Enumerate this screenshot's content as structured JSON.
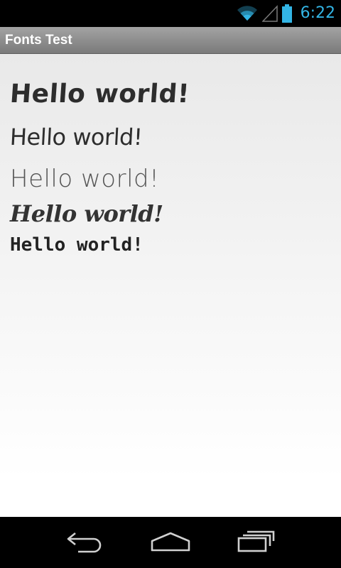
{
  "status_bar": {
    "time": "6:22",
    "icons": [
      "wifi-icon",
      "signal-icon",
      "battery-icon"
    ],
    "accent_color": "#33b5e5"
  },
  "app": {
    "title": "Fonts Test"
  },
  "samples": [
    {
      "text": "Hello world!"
    },
    {
      "text": "Hello world!"
    },
    {
      "text": "Hello world!"
    },
    {
      "text": "Hello world!"
    },
    {
      "text": "Hello world!"
    }
  ],
  "navigation": {
    "buttons": [
      "back-icon",
      "home-icon",
      "recent-apps-icon"
    ]
  }
}
